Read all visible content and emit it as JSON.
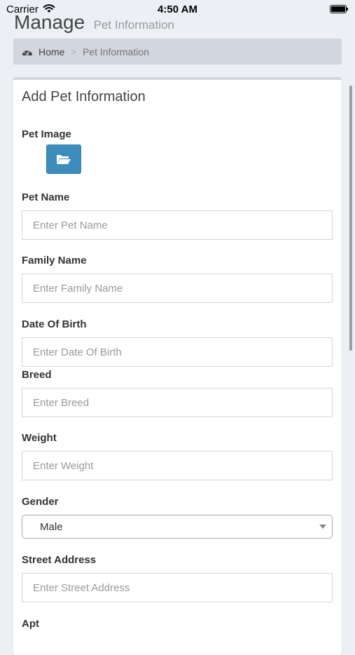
{
  "status_bar": {
    "carrier": "Carrier",
    "time": "4:50 AM"
  },
  "header": {
    "title": "Manage",
    "subtitle": "Pet Information"
  },
  "breadcrumb": {
    "home": "Home",
    "separator": ">",
    "current": "Pet Information"
  },
  "form": {
    "title": "Add Pet Information",
    "pet_image_label": "Pet Image",
    "pet_name": {
      "label": "Pet Name",
      "placeholder": "Enter Pet Name"
    },
    "family_name": {
      "label": "Family Name",
      "placeholder": "Enter Family Name"
    },
    "dob": {
      "label": "Date Of Birth",
      "placeholder": "Enter Date Of Birth"
    },
    "breed": {
      "label": "Breed",
      "placeholder": "Enter Breed"
    },
    "weight": {
      "label": "Weight",
      "placeholder": "Enter Weight"
    },
    "gender": {
      "label": "Gender",
      "value": "Male"
    },
    "street": {
      "label": "Street Address",
      "placeholder": "Enter Street Address"
    },
    "apt": {
      "label": "Apt"
    }
  },
  "colors": {
    "primary": "#3c8dbc",
    "background": "#ecf0f5",
    "breadcrumb_bg": "#d2d6de"
  },
  "icons": [
    "wifi-icon",
    "battery-icon",
    "dashboard-icon",
    "folder-open-icon",
    "chevron-down-icon"
  ]
}
